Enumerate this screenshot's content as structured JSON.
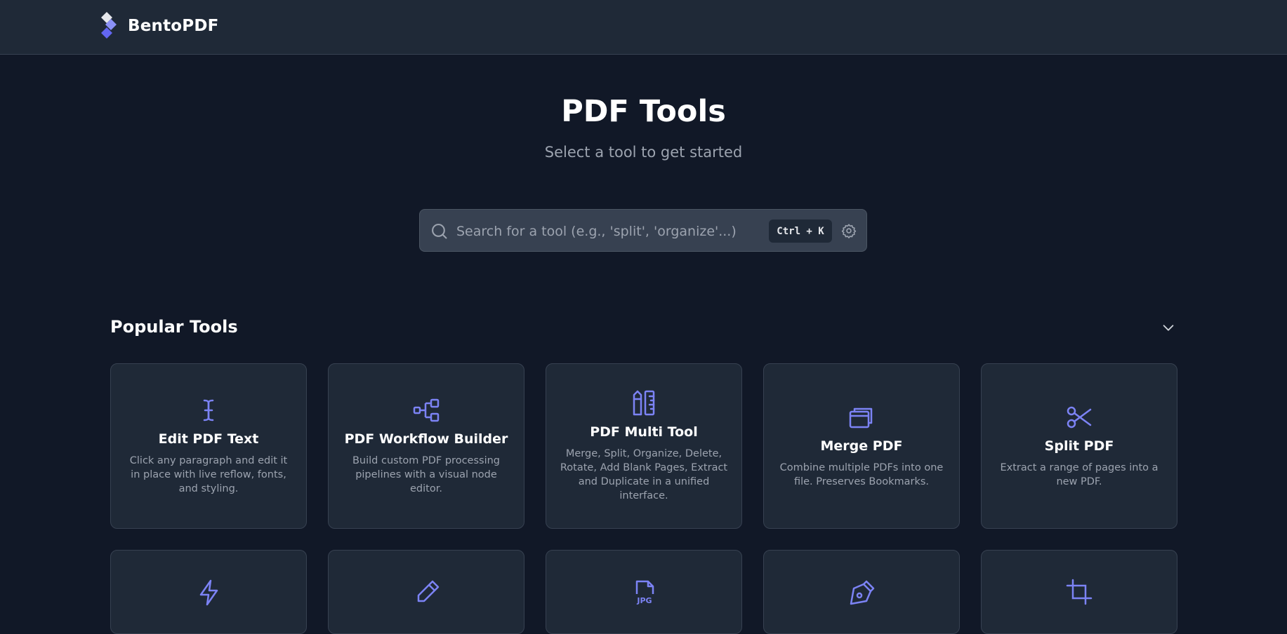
{
  "app": {
    "name": "BentoPDF"
  },
  "hero": {
    "title": "PDF Tools",
    "subtitle": "Select a tool to get started"
  },
  "search": {
    "placeholder": "Search for a tool (e.g., 'split', 'organize'...)",
    "value": "",
    "shortcut": "Ctrl + K"
  },
  "popular": {
    "title": "Popular Tools",
    "cards": [
      {
        "title": "Edit PDF Text",
        "description": "Click any paragraph and edit it in place with live reflow, fonts, and styling.",
        "icon": "text-cursor-icon"
      },
      {
        "title": "PDF Workflow Builder",
        "description": "Build custom PDF processing pipelines with a visual node editor.",
        "icon": "workflow-icon"
      },
      {
        "title": "PDF Multi Tool",
        "description": "Merge, Split, Organize, Delete, Rotate, Add Blank Pages, Extract and Duplicate in a unified interface.",
        "icon": "pencil-ruler-icon"
      },
      {
        "title": "Merge PDF",
        "description": "Combine multiple PDFs into one file. Preserves Bookmarks.",
        "icon": "stacked-windows-icon"
      },
      {
        "title": "Split PDF",
        "description": "Extract a range of pages into a new PDF.",
        "icon": "scissors-icon"
      }
    ],
    "partial_cards": [
      "lightning-icon",
      "pencil-icon",
      "jpg-file-icon",
      "pen-nib-icon",
      "crop-icon"
    ]
  },
  "colors": {
    "accent": "#7c83f5",
    "background": "#111827",
    "surface": "#1f2937",
    "border": "#374151"
  }
}
